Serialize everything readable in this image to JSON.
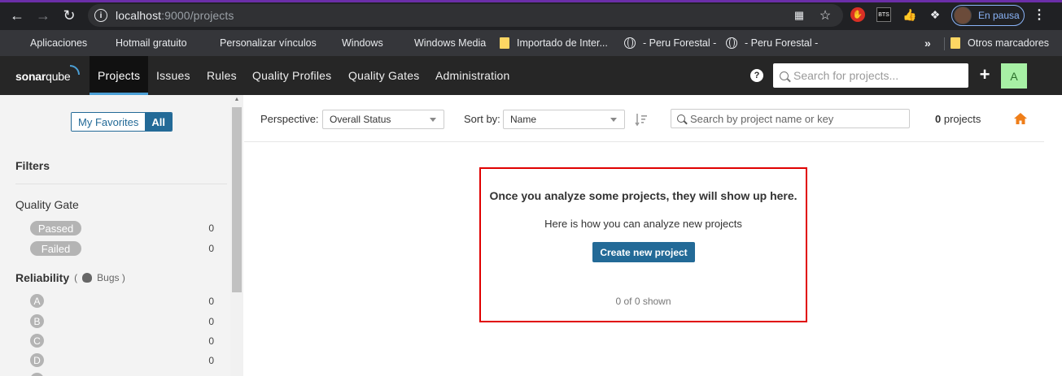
{
  "browser": {
    "url_host": "localhost",
    "url_rest": ":9000/projects",
    "profile_status": "En pausa",
    "bookmarks": [
      {
        "label": "Aplicaciones",
        "icon": "apps-grid-icon"
      },
      {
        "label": "Hotmail gratuito",
        "icon": "microsoft-icon"
      },
      {
        "label": "Personalizar vínculos",
        "icon": "microsoft-icon"
      },
      {
        "label": "Windows",
        "icon": "microsoft-icon"
      },
      {
        "label": "Windows Media",
        "icon": "microsoft-icon"
      },
      {
        "label": "Importado de Inter...",
        "icon": "folder-icon"
      },
      {
        "label": "- Peru Forestal -",
        "icon": "globe-icon"
      },
      {
        "label": "- Peru Forestal -",
        "icon": "globe-icon"
      }
    ],
    "overflow": "»",
    "other_bookmarks": "Otros marcadores"
  },
  "sonar": {
    "logo_a": "sonar",
    "logo_b": "qube",
    "nav": [
      "Projects",
      "Issues",
      "Rules",
      "Quality Profiles",
      "Quality Gates",
      "Administration"
    ],
    "search_placeholder": "Search for projects...",
    "avatar_letter": "A"
  },
  "sidebar": {
    "favorites_label": "My Favorites",
    "all_label": "All",
    "filters_title": "Filters",
    "quality_gate": {
      "title": "Quality Gate",
      "options": [
        {
          "label": "Passed",
          "count": "0"
        },
        {
          "label": "Failed",
          "count": "0"
        }
      ]
    },
    "reliability": {
      "title": "Reliability",
      "paren_open": "(",
      "sub": "Bugs",
      "paren_close": ")",
      "ratings": [
        {
          "label": "A",
          "count": "0"
        },
        {
          "label": "B",
          "count": "0"
        },
        {
          "label": "C",
          "count": "0"
        },
        {
          "label": "D",
          "count": "0"
        }
      ]
    }
  },
  "main": {
    "perspective_label": "Perspective:",
    "perspective_value": "Overall Status",
    "sort_label": "Sort by:",
    "sort_value": "Name",
    "search_placeholder": "Search by project name or key",
    "project_count": "0",
    "project_count_suffix": " projects",
    "empty_title": "Once you analyze some projects, they will show up here.",
    "empty_sub": "Here is how you can analyze new projects",
    "create_button": "Create new project",
    "shown": "0 of 0 shown"
  },
  "colors": {
    "sonar_blue": "#236a97",
    "highlight_red": "#e00000",
    "home_orange": "#ef7e19"
  }
}
